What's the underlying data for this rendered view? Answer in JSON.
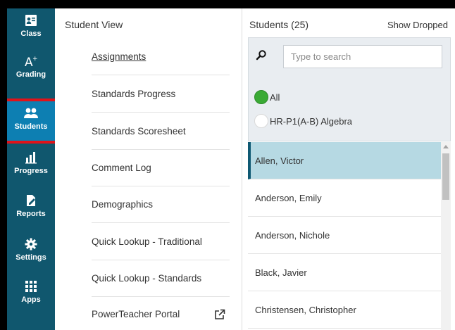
{
  "nav": {
    "items": [
      {
        "label": "Class",
        "icon": "class-icon"
      },
      {
        "label": "Grading",
        "icon": "grading-icon"
      },
      {
        "label": "Students",
        "icon": "students-icon"
      },
      {
        "label": "Progress",
        "icon": "progress-icon"
      },
      {
        "label": "Reports",
        "icon": "reports-icon"
      },
      {
        "label": "Settings",
        "icon": "gear-icon"
      },
      {
        "label": "Apps",
        "icon": "apps-grid-icon"
      }
    ],
    "active": "Students",
    "colors": {
      "background": "#10576e",
      "active": "#0d7fb2",
      "highlight": "#e0131a"
    }
  },
  "student_view": {
    "title": "Student View",
    "menu": [
      "Assignments",
      "Standards Progress",
      "Standards Scoresheet",
      "Comment Log",
      "Demographics",
      "Quick Lookup - Traditional",
      "Quick Lookup - Standards",
      "PowerTeacher Portal"
    ]
  },
  "students": {
    "title": "Students (25)",
    "show_dropped": "Show Dropped",
    "search_placeholder": "Type to search",
    "filters": [
      {
        "label": "All",
        "selected": true
      },
      {
        "label": "HR-P1(A-B) Algebra",
        "selected": false
      }
    ],
    "list": [
      "Allen, Victor",
      "Anderson, Emily",
      "Anderson, Nichole",
      "Black, Javier",
      "Christensen, Christopher"
    ],
    "selected_student": "Allen, Victor"
  }
}
